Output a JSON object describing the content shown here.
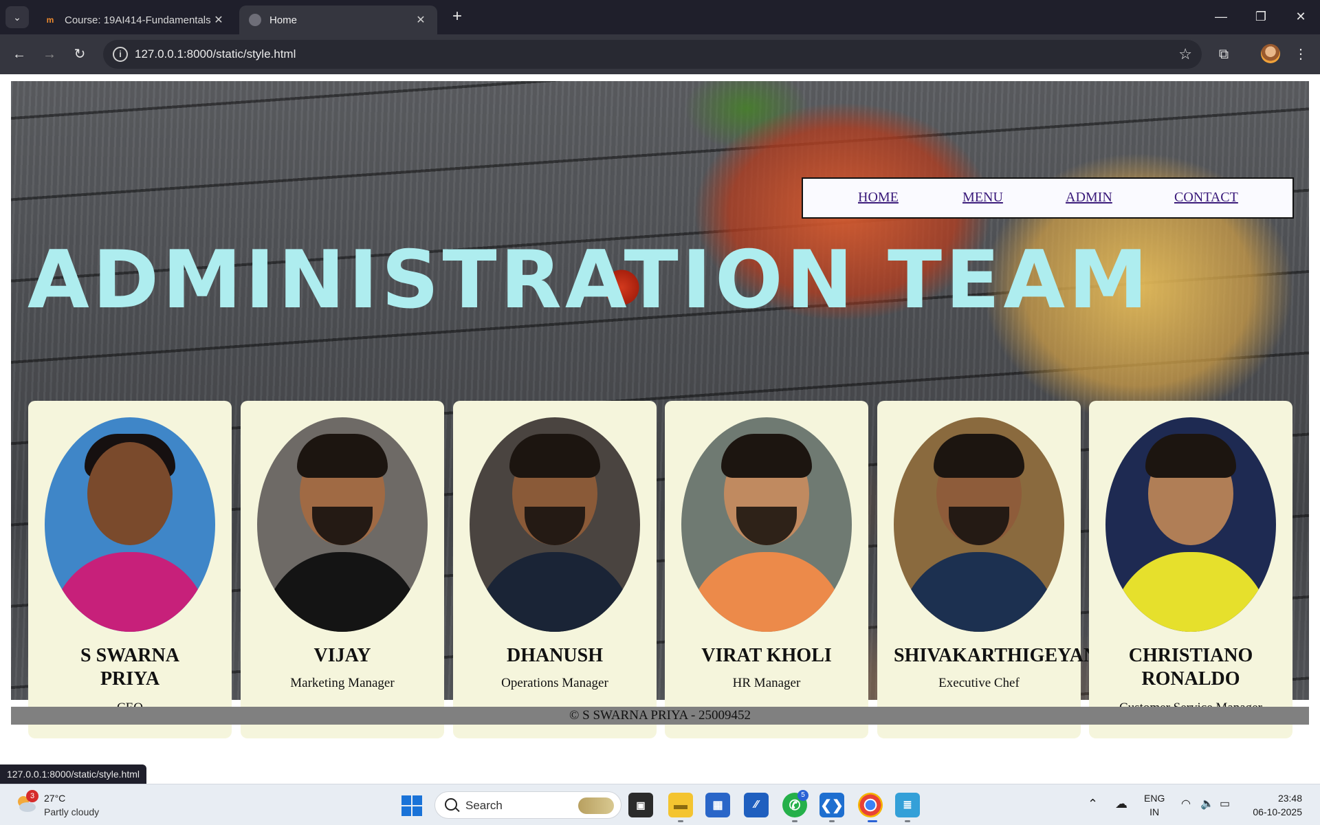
{
  "browser": {
    "tabs": [
      {
        "title": "Course: 19AI414-Fundamentals",
        "favicon": "moodle-icon",
        "active": false
      },
      {
        "title": "Home",
        "favicon": "globe-icon",
        "active": true
      }
    ],
    "url": "127.0.0.1:8000/static/style.html",
    "status_url": "127.0.0.1:8000/static/style.html"
  },
  "page": {
    "nav": [
      "HOME",
      "MENU",
      "ADMIN",
      "CONTACT"
    ],
    "title": "ADMINISTRATION TEAM",
    "team": [
      {
        "name": "S SWARNA PRIYA",
        "role": "CEO"
      },
      {
        "name": "VIJAY",
        "role": "Marketing Manager"
      },
      {
        "name": "DHANUSH",
        "role": "Operations Manager"
      },
      {
        "name": "VIRAT KHOLI",
        "role": "HR Manager"
      },
      {
        "name": "SHIVAKARTHIGEYAN",
        "role": "Executive Chef"
      },
      {
        "name": "CHRISTIANO RONALDO",
        "role": "Customer Service Manager"
      }
    ],
    "footer": "© S SWARNA PRIYA - 25009452",
    "colors": {
      "title": "#aeedef",
      "card": "#f5f5dc",
      "footer": "#808080",
      "nav_link": "#3a1a7a"
    }
  },
  "taskbar": {
    "weather_temp": "27°C",
    "weather_cond": "Partly cloudy",
    "weather_badge": "3",
    "search_label": "Search",
    "whatsapp_badge": "5",
    "lang_1": "ENG",
    "lang_2": "IN",
    "time": "23:48",
    "date": "06-10-2025"
  }
}
